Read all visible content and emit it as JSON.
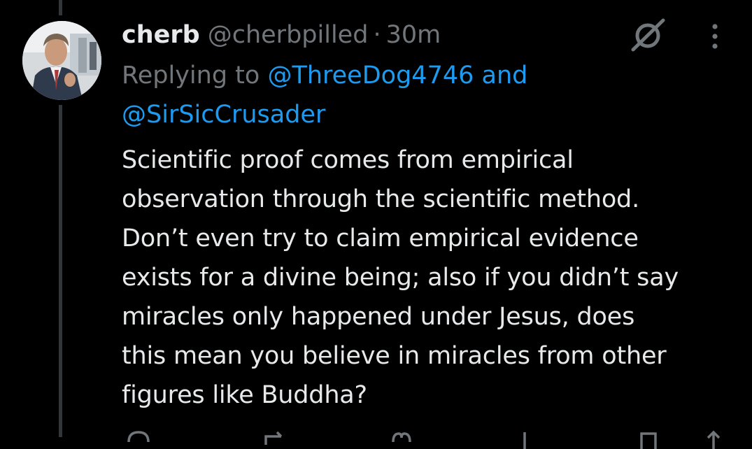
{
  "tweet": {
    "display_name": "cherb",
    "handle": "@cherbpilled",
    "separator": "·",
    "time": "30m",
    "replying_prefix": "Replying to",
    "mention_1": "@ThreeDog4746",
    "conjunction": "and",
    "mention_2": "@SirSicCrusader",
    "text": "Scientific proof comes from empirical\nobservation through the scientific method.\nDon’t even try to claim empirical evidence\nexists for a divine being; also if you didn’t say\nmiracles only happened under Jesus, does\nthis mean you believe in miracles from other\nfigures like Buddha?"
  },
  "icons": {
    "avatar": "profile-photo",
    "grok": "grok-icon",
    "more": "more-vertical-icon",
    "actions": [
      "reply-icon",
      "retweet-icon",
      "like-icon",
      "views-icon",
      "bookmark-icon",
      "share-icon"
    ]
  },
  "colors": {
    "background": "#000000",
    "text_primary": "#e7e9ea",
    "text_secondary": "#71767b",
    "link": "#1d9bf0",
    "thread_line": "#333639"
  }
}
